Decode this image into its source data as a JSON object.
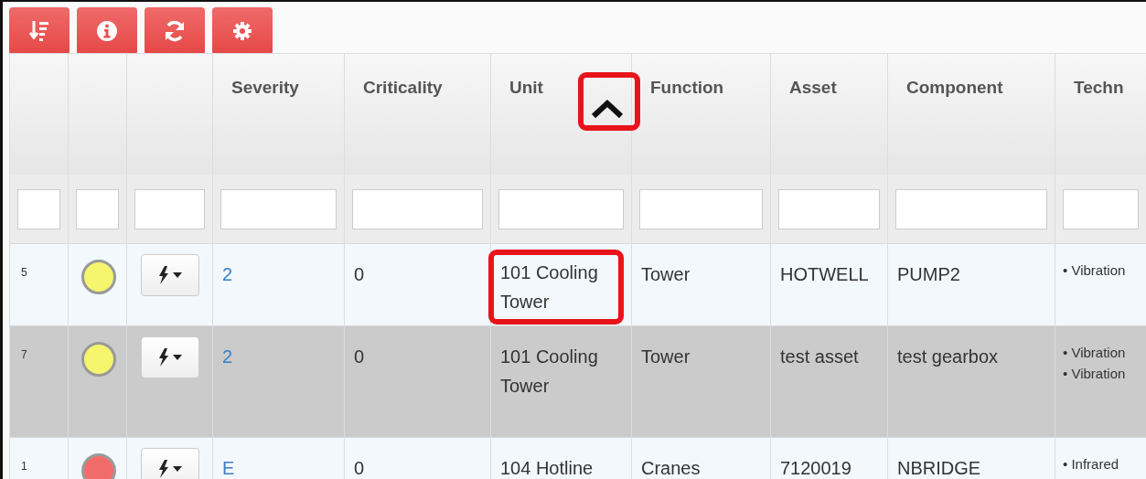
{
  "toolbar": [
    {
      "kind": "sort"
    },
    {
      "kind": "info"
    },
    {
      "kind": "refresh"
    },
    {
      "kind": "settings"
    }
  ],
  "columns": [
    {
      "sorted": false
    },
    {
      "sorted": false
    },
    {
      "sorted": false
    },
    {
      "label": "Severity",
      "sorted": false
    },
    {
      "label": "Criticality",
      "sorted": false
    },
    {
      "label": "Unit",
      "sorted": true
    },
    {
      "label": "Function",
      "sorted": false
    },
    {
      "label": "Asset",
      "sorted": false
    },
    {
      "label": "Component",
      "sorted": false
    },
    {
      "label": "Techn",
      "sorted": false
    }
  ],
  "sort_icon_highlighted": true,
  "rows": [
    {
      "number": "5",
      "color": "#f5f56e",
      "selected": false,
      "severity": "2",
      "criticality": "0",
      "unit": "101 Cooling Tower",
      "unit_highlighted": true,
      "function": "Tower",
      "asset": "HOTWELL",
      "component": "PUMP2",
      "technologies": [
        "• Vibration"
      ]
    },
    {
      "number": "7",
      "color": "#f5f56e",
      "selected": true,
      "severity": "2",
      "criticality": "0",
      "unit": "101 Cooling Tower",
      "unit_highlighted": false,
      "function": "Tower",
      "asset": "test asset",
      "component": "test gearbox",
      "technologies": [
        "• Vibration",
        "• Vibration"
      ]
    },
    {
      "number": "1",
      "color": "#f26b6b",
      "selected": false,
      "severity": "E",
      "criticality": "0",
      "unit": "104 Hotline",
      "unit_highlighted": false,
      "function": "Cranes",
      "asset": "7120019",
      "component": "NBRIDGE",
      "technologies": [
        "• Infrared"
      ]
    }
  ]
}
